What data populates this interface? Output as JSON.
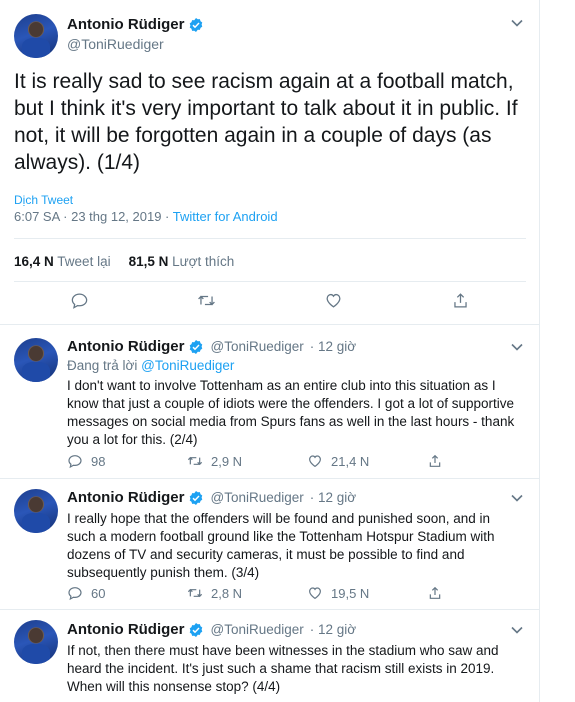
{
  "main_tweet": {
    "name": "Antonio Rüdiger",
    "handle": "@ToniRuediger",
    "text": "It is really sad to see racism again at a football match, but I think it's very important to talk about it in public. If not, it will be forgotten again in a couple of days (as always). (1/4)",
    "translate": "Dịch Tweet",
    "time": "6:07 SA · 23 thg 12, 2019 · ",
    "source": "Twitter for Android",
    "retweets_count": "16,4 N",
    "retweets_label": "Tweet lại",
    "likes_count": "81,5 N",
    "likes_label": "Lượt thích"
  },
  "replies": [
    {
      "name": "Antonio Rüdiger",
      "handle": "@ToniRuediger",
      "time": "· 12 giờ",
      "replying_prefix": "Đang trả lời ",
      "replying_to": "@ToniRuediger",
      "text": "I don't want to involve Tottenham as an entire club into this situation as I know that just a couple of idiots were the offenders. I got a lot of supportive messages on social media from Spurs fans as well in the last hours - thank you a lot for this. (2/4)",
      "replies": "98",
      "retweets": "2,9 N",
      "likes": "21,4 N"
    },
    {
      "name": "Antonio Rüdiger",
      "handle": "@ToniRuediger",
      "time": "· 12 giờ",
      "text": "I really hope that the offenders will be found and punished soon, and in such a modern football ground like the Tottenham Hotspur Stadium with dozens of TV and security cameras, it must be possible to find and subsequently punish them. (3/4)",
      "replies": "60",
      "retweets": "2,8 N",
      "likes": "19,5 N"
    },
    {
      "name": "Antonio Rüdiger",
      "handle": "@ToniRuediger",
      "time": "· 12 giờ",
      "text": "If not, then there must have been witnesses in the stadium who saw and heard the incident. It's just such a shame that racism still exists in 2019. When will this nonsense stop? (4/4)"
    }
  ],
  "colors": {
    "accent": "#1da1f2",
    "muted": "#657786",
    "text": "#14171a",
    "border": "#e6ecf0"
  },
  "icons": [
    "verified-badge-icon",
    "chevron-down-icon",
    "reply-icon",
    "retweet-icon",
    "like-icon",
    "share-icon"
  ]
}
